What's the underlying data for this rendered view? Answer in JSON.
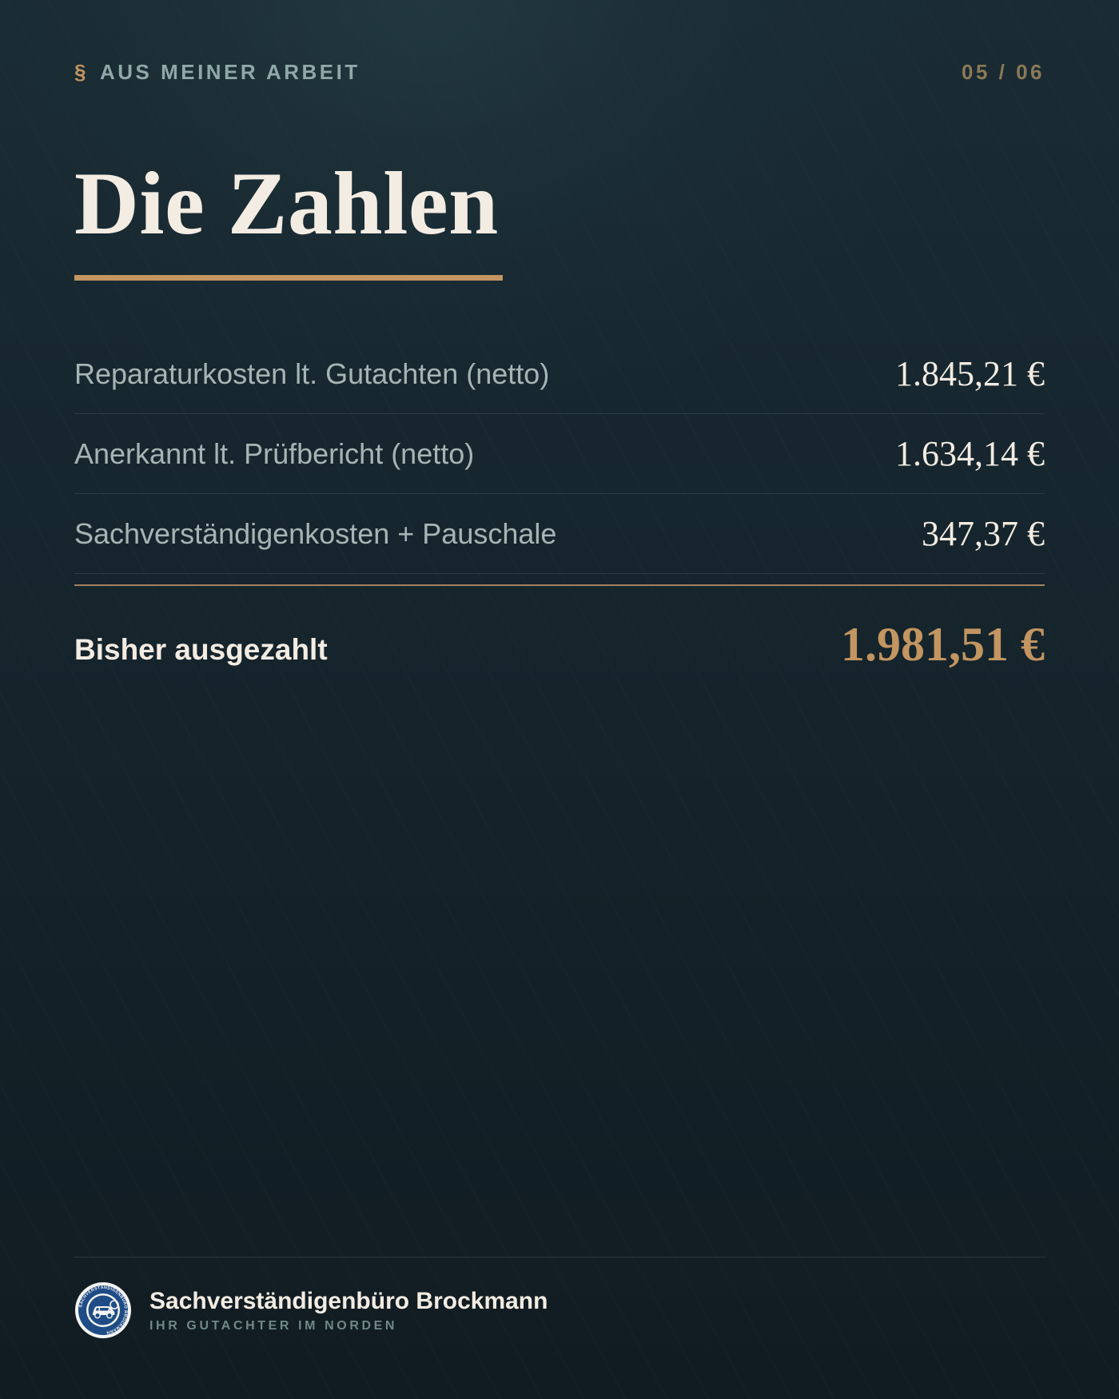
{
  "header": {
    "section_symbol": "§",
    "eyebrow": "AUS MEINER ARBEIT",
    "pager": "05 / 06"
  },
  "title": "Die Zahlen",
  "rows": [
    {
      "label": "Reparaturkosten lt. Gutachten (netto)",
      "value": "1.845,21 €"
    },
    {
      "label": "Anerkannt lt. Prüfbericht (netto)",
      "value": "1.634,14 €"
    },
    {
      "label": "Sachverständigenkosten + Pauschale",
      "value": "347,37 €"
    }
  ],
  "total": {
    "label": "Bisher ausgezahlt",
    "value": "1.981,51 €"
  },
  "footer": {
    "brand_name": "Sachverständigenbüro Brockmann",
    "tagline": "IHR GUTACHTER IM NORDEN",
    "logo_icon": "car-seal-logo-icon",
    "logo_ring_text": "SACHVERSTÄNDIGENBÜRO BROCKMANN"
  },
  "colors": {
    "background": "#16252d",
    "accent_gold": "#c29561",
    "text_light": "#f3ece2",
    "text_muted": "#a7b4b4",
    "logo_blue": "#1f4c86"
  }
}
